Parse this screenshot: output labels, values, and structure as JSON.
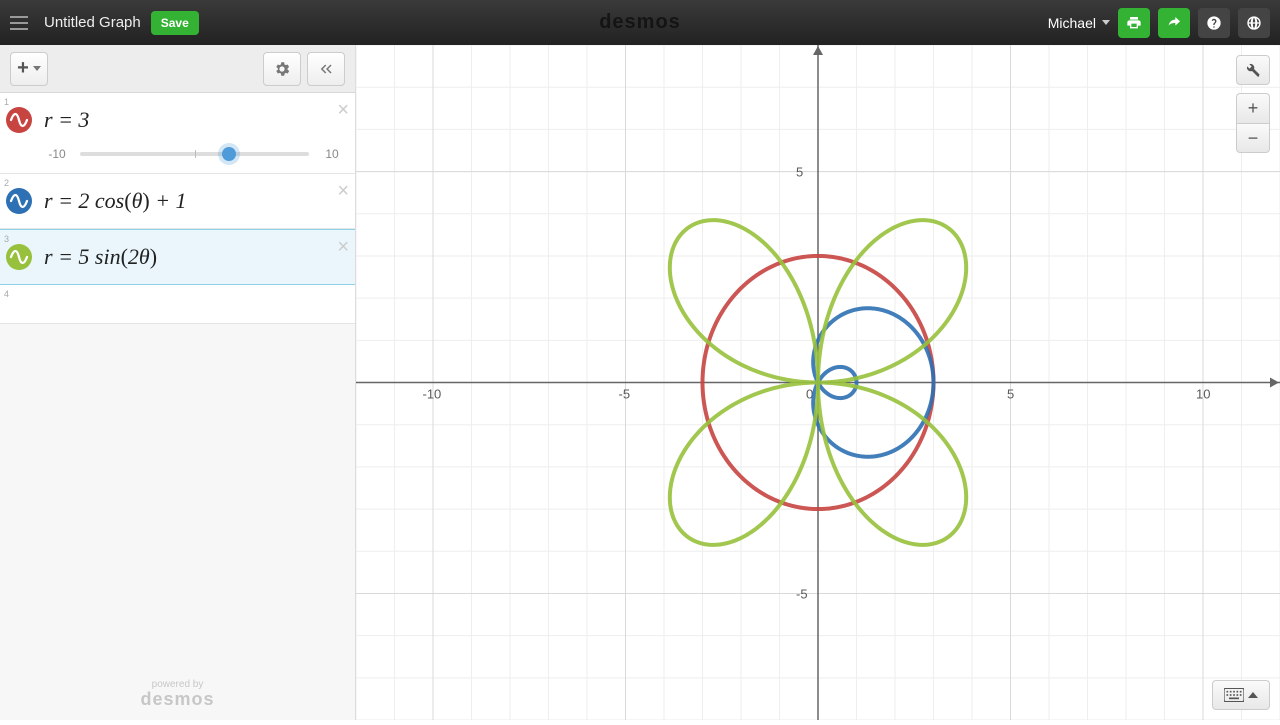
{
  "header": {
    "title": "Untitled Graph",
    "save_label": "Save",
    "logo": "desmos",
    "user": "Michael"
  },
  "sidebar": {
    "powered_small": "powered by",
    "powered_big": "desmos"
  },
  "expressions": [
    {
      "index": "1",
      "color": "#c74440",
      "formula_html": "r = 3",
      "slider": {
        "min": "-10",
        "max": "10",
        "value": 3,
        "range_min": -10,
        "range_max": 10
      }
    },
    {
      "index": "2",
      "color": "#2d70b3",
      "formula_html": "r = 2 cos(θ) + 1"
    },
    {
      "index": "3",
      "color": "#97c13c",
      "formula_html": "r = 5 sin(2θ)",
      "selected": true
    },
    {
      "index": "4",
      "empty": true
    }
  ],
  "chart_data": {
    "type": "polar-plot",
    "title": "",
    "x_range": [
      -12,
      12
    ],
    "y_range": [
      -8,
      8
    ],
    "x_ticks": [
      -10,
      -5,
      0,
      5,
      10
    ],
    "y_ticks": [
      -5,
      0,
      5
    ],
    "grid": true,
    "series": [
      {
        "name": "r = 3",
        "color": "#c74440",
        "kind": "polar",
        "equation": "r = 3"
      },
      {
        "name": "r = 2 cos(θ) + 1",
        "color": "#2d70b3",
        "kind": "polar",
        "equation": "r = 2*cos(theta) + 1"
      },
      {
        "name": "r = 5 sin(2 θ)",
        "color": "#97c13c",
        "kind": "polar",
        "equation": "r = 5*sin(2*theta)"
      }
    ]
  }
}
